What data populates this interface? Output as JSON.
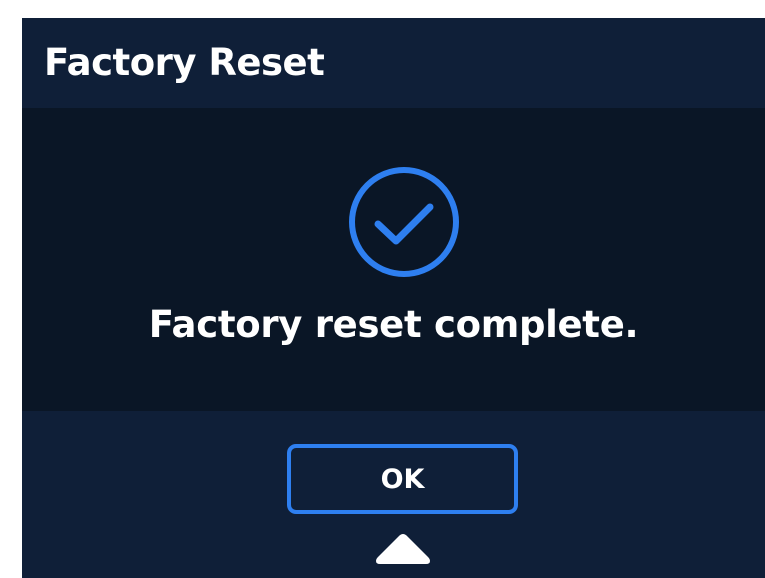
{
  "header": {
    "title": "Factory Reset"
  },
  "dialog": {
    "icon": "check-circle-icon",
    "message": "Factory reset complete."
  },
  "footer": {
    "ok_label": "OK",
    "indicator_icon": "up-arrow-icon"
  },
  "colors": {
    "background": "#0f1f38",
    "content_background": "#0a1626",
    "accent": "#2e7ff0",
    "text": "#ffffff"
  }
}
